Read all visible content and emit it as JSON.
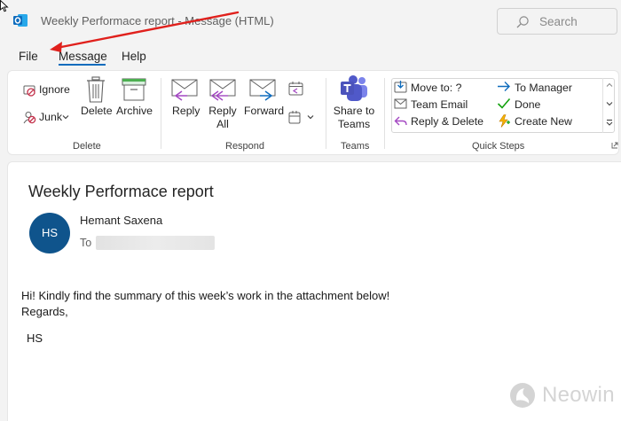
{
  "window": {
    "title": "Weekly Performace report  -  Message (HTML)",
    "app_icon": "outlook-icon",
    "search_placeholder": "Search"
  },
  "menu": {
    "tabs": [
      {
        "label": "File",
        "active": false
      },
      {
        "label": "Message",
        "active": true
      },
      {
        "label": "Help",
        "active": false
      }
    ]
  },
  "ribbon": {
    "delete_group": {
      "label": "Delete",
      "ignore": "Ignore",
      "junk": "Junk",
      "delete": "Delete",
      "archive": "Archive"
    },
    "respond_group": {
      "label": "Respond",
      "reply": "Reply",
      "reply_all_1": "Reply",
      "reply_all_2": "All",
      "forward": "Forward"
    },
    "teams_group": {
      "label": "Teams",
      "share_1": "Share to",
      "share_2": "Teams"
    },
    "quick_steps": {
      "label": "Quick Steps",
      "items": [
        {
          "label": "Move to: ?",
          "icon": "move-to-folder-icon"
        },
        {
          "label": "Team Email",
          "icon": "team-email-icon"
        },
        {
          "label": "Reply & Delete",
          "icon": "reply-delete-icon"
        },
        {
          "label": "To Manager",
          "icon": "arrow-right-icon"
        },
        {
          "label": "Done",
          "icon": "checkmark-icon"
        },
        {
          "label": "Create New",
          "icon": "lightning-icon"
        }
      ]
    }
  },
  "message": {
    "subject": "Weekly Performace report",
    "sender_initials": "HS",
    "sender_name": "Hemant Saxena",
    "to_label": "To",
    "body": [
      "Hi! Kindly find the summary of this week’s work in the attachment below!",
      "Regards,",
      "HS"
    ]
  },
  "watermark": {
    "text": "Neowin"
  },
  "colors": {
    "accent": "#0f6cbd",
    "avatar": "#0f548c",
    "annotation_arrow": "#e0201c"
  }
}
